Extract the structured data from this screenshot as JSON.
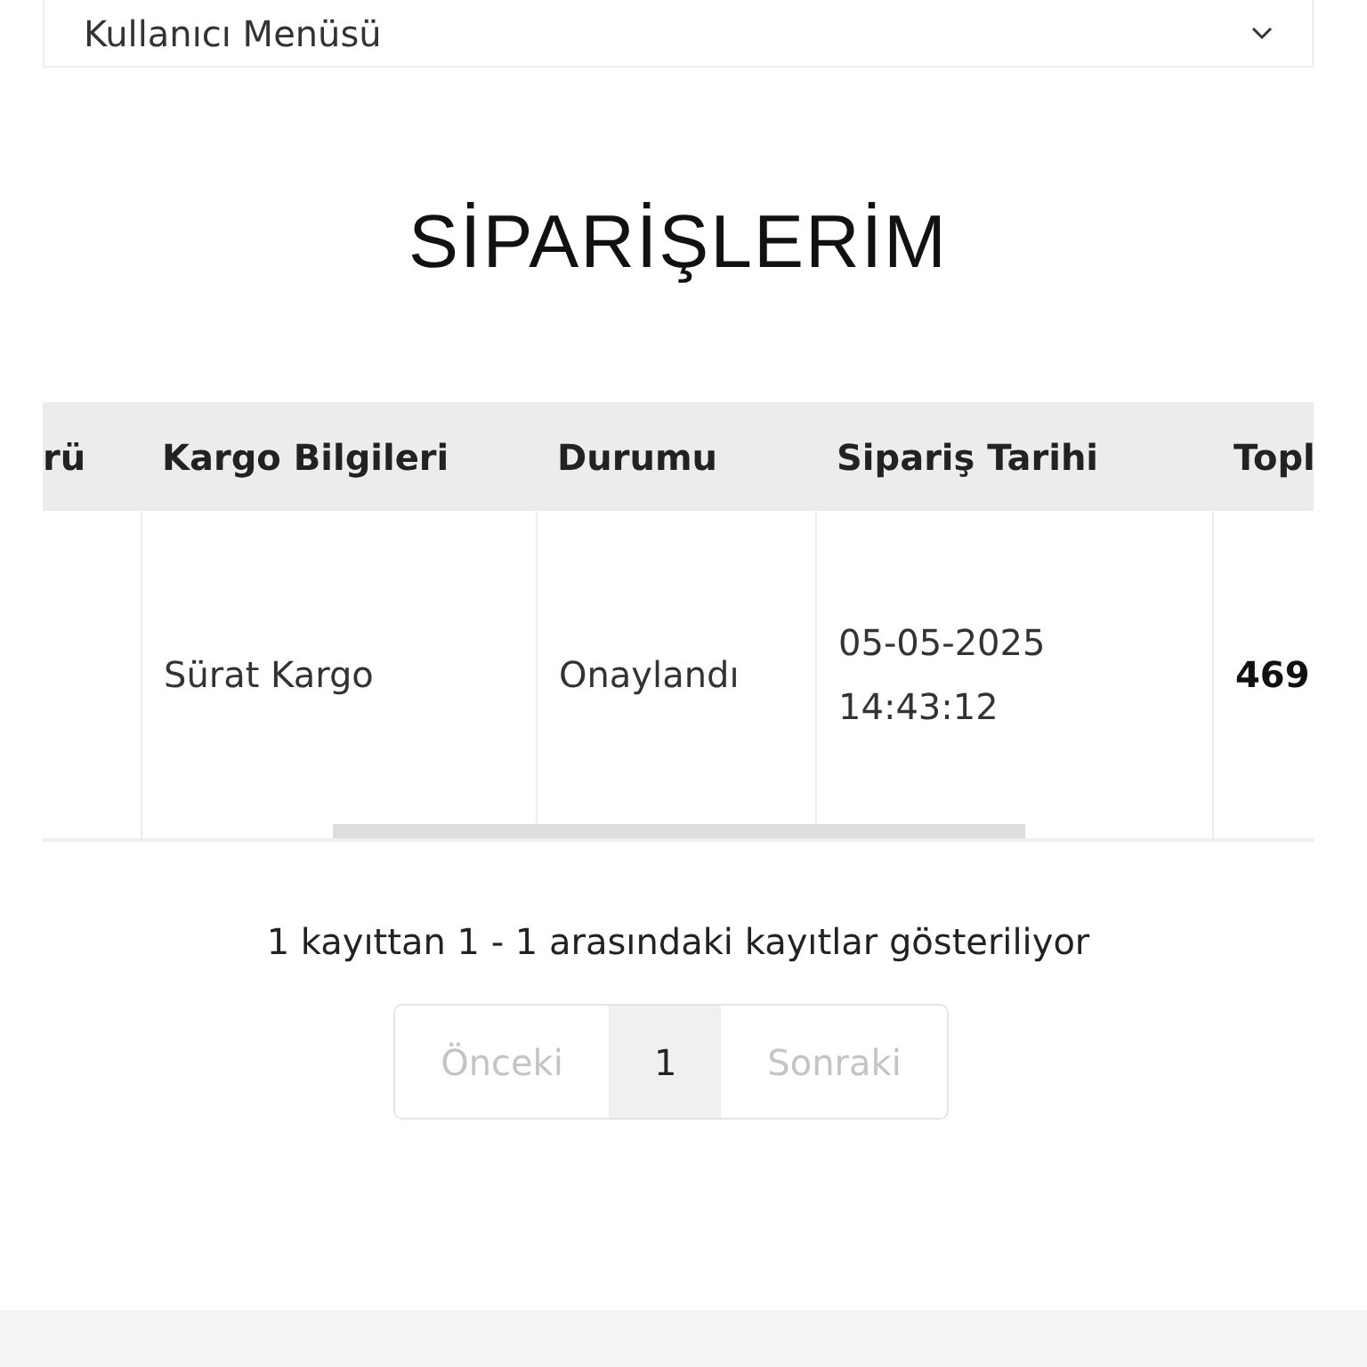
{
  "user_menu": {
    "label": "Kullanıcı Menüsü",
    "expanded": false
  },
  "title": "SİPARİŞLERİM",
  "table": {
    "columns": [
      "rü",
      "Kargo Bilgileri",
      "Durumu",
      "Sipariş Tarihi",
      "Topl"
    ],
    "rows": [
      {
        "cells": [
          "",
          "Sürat Kargo",
          "Onaylandı",
          "05-05-2025\n14:43:12",
          "469"
        ]
      }
    ]
  },
  "info": "1 kayıttan 1 - 1 arasındaki kayıtlar gösteriliyor",
  "pagination": [
    {
      "label": "Önceki",
      "kind": "prev",
      "disabled": true,
      "selected": false
    },
    {
      "label": "1",
      "kind": "page",
      "disabled": false,
      "selected": true
    },
    {
      "label": "Sonraki",
      "kind": "next",
      "disabled": true,
      "selected": false
    }
  ]
}
